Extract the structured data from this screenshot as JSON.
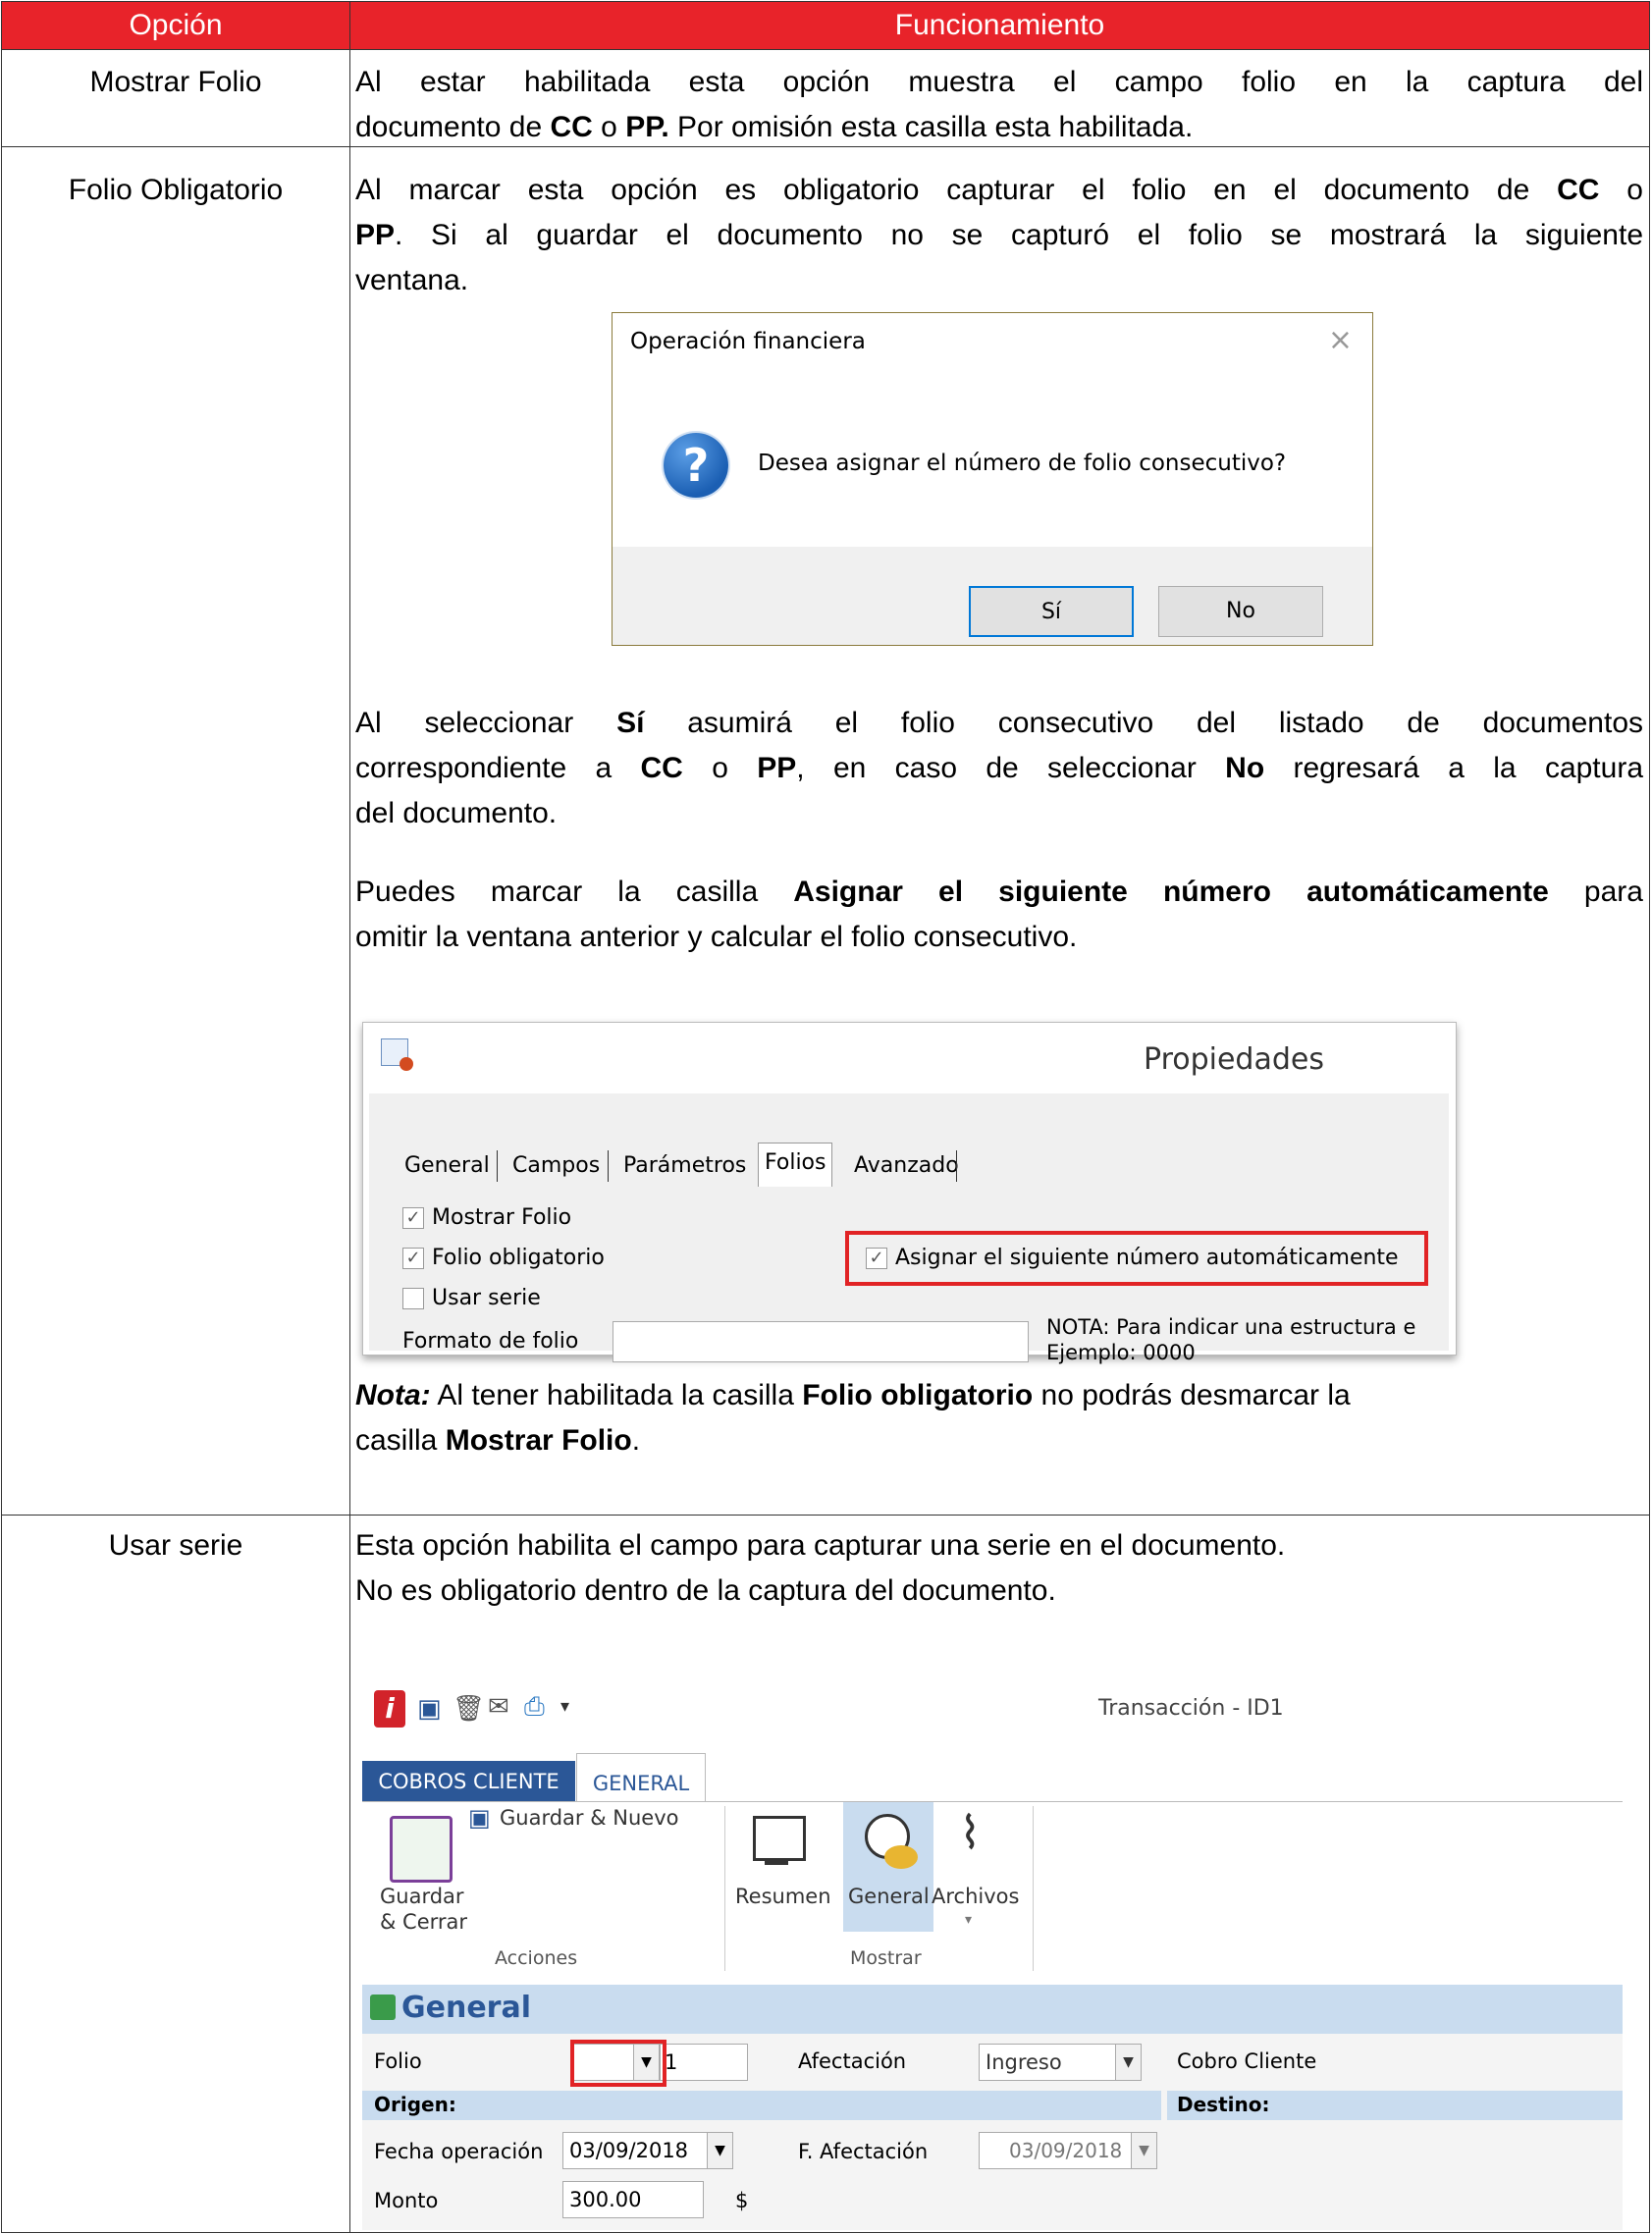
{
  "header": {
    "col_option": "Opción",
    "col_function": "Funcionamiento"
  },
  "rows": [
    {
      "option": "Mostrar Folio",
      "p1_a": "Al estar habilitada esta opción muestra el campo folio en la captura del",
      "p1_b1": "documento de ",
      "p1_b_cc": "CC",
      "p1_b2": " o ",
      "p1_b_pp": "PP.",
      "p1_b3": " Por omisión esta casilla esta habilitada."
    },
    {
      "option": "Folio Obligatorio",
      "p1_a1": "Al marcar esta opción es obligatorio capturar el folio en el documento de ",
      "p1_a_cc": "CC",
      "p1_a2": " o",
      "p1_b_pp": "PP",
      "p1_b1": ". Si al guardar el documento no se capturó el folio se mostrará la siguiente",
      "p1_c": "ventana.",
      "p2_a1": "Al seleccionar ",
      "p2_a_si": "Sí",
      "p2_a2": " asumirá el folio consecutivo del listado de documentos",
      "p2_b1": "correspondiente a ",
      "p2_b_cc": "CC",
      "p2_b2": " o ",
      "p2_b_pp": "PP",
      "p2_b3": ", en caso de seleccionar ",
      "p2_b_no": "No",
      "p2_b4": " regresará a la captura",
      "p2_c": "del documento.",
      "p3_a1": "Puedes marcar la casilla ",
      "p3_a_b": "Asignar el siguiente número automáticamente",
      "p3_a2": " para",
      "p3_b": "omitir la ventana anterior y calcular el folio consecutivo.",
      "note_label": "Nota:",
      "note_a1": " Al tener habilitada la casilla ",
      "note_a_b": "Folio obligatorio",
      "note_a2": " no podrás desmarcar la",
      "note_b1": "casilla ",
      "note_b_b": "Mostrar Folio",
      "note_b2": "."
    },
    {
      "option": "Usar serie",
      "p1_a": "Esta opción habilita el campo para capturar una serie en el documento.",
      "p1_b": "No es obligatorio dentro de la captura del documento."
    }
  ],
  "dialog": {
    "title": "Operación financiera",
    "close": "×",
    "icon": "question-icon",
    "message": "Desea asignar el número de folio consecutivo?",
    "btn_yes": "Sí",
    "btn_no": "No"
  },
  "properties": {
    "title": "Propiedades",
    "tabs": [
      "General",
      "Campos",
      "Parámetros",
      "Folios",
      "Avanzado"
    ],
    "active_tab": "Folios",
    "chk_show_folio": "Mostrar Folio",
    "chk_required_folio": "Folio obligatorio",
    "chk_use_series": "Usar serie",
    "chk_auto_number": "Asignar el siguiente número automáticamente",
    "checked": {
      "show_folio": true,
      "required_folio": true,
      "use_series": false,
      "auto_number": true
    },
    "format_label": "Formato de folio",
    "format_value": "",
    "note_line1": "NOTA: Para indicar una estructura e",
    "note_line2": "Ejemplo: 0000"
  },
  "transaction": {
    "window_title": "Transacción - ID1",
    "tab_cobros": "COBROS CLIENTE",
    "tab_general": "GENERAL",
    "btn_save_new": "Guardar & Nuevo",
    "btn_save_close_1": "Guardar",
    "btn_save_close_2": "& Cerrar",
    "group_actions": "Acciones",
    "btn_summary": "Resumen",
    "btn_general": "General",
    "btn_files": "Archivos",
    "group_show": "Mostrar",
    "section_title": "General",
    "lbl_folio": "Folio",
    "folio_series": "",
    "folio_number": "1",
    "lbl_afectacion": "Afectación",
    "afectacion_value": "Ingreso",
    "lbl_cobro": "Cobro Cliente",
    "lbl_origen": "Origen:",
    "lbl_destino": "Destino:",
    "lbl_fecha_op": "Fecha operación",
    "fecha_op_value": "03/09/2018",
    "lbl_f_afect": "F. Afectación",
    "f_afect_value": "03/09/2018",
    "lbl_monto": "Monto",
    "monto_value": "300.00",
    "currency": "$"
  },
  "colors": {
    "header_red": "#e8232a",
    "highlight_red": "#e12325",
    "ribbon_blue": "#2b5797",
    "section_blue": "#c9dcef"
  }
}
